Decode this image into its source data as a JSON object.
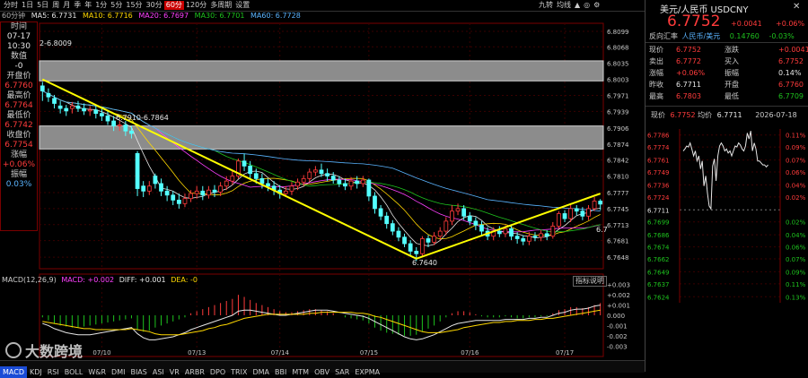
{
  "toolbar": {
    "periods": [
      "分时",
      "1日",
      "5日",
      "周",
      "月",
      "季",
      "年",
      "1分",
      "5分",
      "15分",
      "30分",
      "60分",
      "120分",
      "多周期",
      "设置"
    ],
    "active_period": "60分",
    "right_items": [
      "九转",
      "均线",
      "▲",
      "◎",
      "⚙"
    ]
  },
  "infobar": {
    "period": "60分钟",
    "ma5": "MA5: 6.7731",
    "ma10": "MA10: 6.7716",
    "ma20": "MA20: 6.7697",
    "ma30": "MA30: 6.7701",
    "ma60": "MA60: 6.7728"
  },
  "leftpanel": {
    "items": [
      {
        "label": "时间",
        "value": "07-17",
        "cls": "wht"
      },
      {
        "label": "",
        "value": "10:30",
        "cls": "wht"
      },
      {
        "label": "数值",
        "value": "-0",
        "cls": "wht"
      },
      {
        "label": "开盘价",
        "value": "6.7760",
        "cls": "red"
      },
      {
        "label": "最高价",
        "value": "6.7764",
        "cls": "red"
      },
      {
        "label": "最低价",
        "value": "6.7742",
        "cls": "red"
      },
      {
        "label": "收盘价",
        "value": "6.7754",
        "cls": "red"
      },
      {
        "label": "涨幅",
        "value": "+0.06%",
        "cls": "red"
      },
      {
        "label": "振幅",
        "value": "0.03%",
        "cls": "cyn"
      }
    ]
  },
  "annotations": {
    "zone_top_label": "2-6.8009",
    "zone_mid_label": "6.7910-6.7864",
    "low_label": "6.7640",
    "right_edge_label": "6.7"
  },
  "macd_header": {
    "title": "MACD(12,26,9)",
    "macd": "MACD: +0.002",
    "diff": "DIFF: +0.001",
    "dea": "DEA: -0",
    "button": "指标说明"
  },
  "watermark": "大数跨境",
  "bottom_tabs": [
    "MACD",
    "KDJ",
    "RSI",
    "BOLL",
    "W&R",
    "DMI",
    "BIAS",
    "ASI",
    "VR",
    "ARBR",
    "DPO",
    "TRIX",
    "DMA",
    "BBI",
    "MTM",
    "OBV",
    "SAR",
    "EXPMA"
  ],
  "bottom_active": "MACD",
  "right": {
    "name": "美元/人民币 USDCNY",
    "price": "6.7752",
    "change": "+0.0041",
    "change_pct": "+0.06%",
    "subtitle_label": "反向汇率",
    "subtitle_pair": "人民币/美元",
    "subtitle_rate": "0.14760",
    "subtitle_pct": "-0.03%",
    "rows": [
      {
        "l1": "现价",
        "v1": "6.7752",
        "c1": "red",
        "l2": "涨跌",
        "v2": "+0.0041",
        "c2": "red"
      },
      {
        "l1": "卖出",
        "v1": "6.7772",
        "c1": "red",
        "l2": "买入",
        "v2": "6.7752",
        "c2": "red"
      },
      {
        "l1": "涨幅",
        "v1": "+0.06%",
        "c1": "red",
        "l2": "振幅",
        "v2": "0.14%",
        "c2": "wht"
      },
      {
        "l1": "昨收",
        "v1": "6.7711",
        "c1": "wht",
        "l2": "开盘",
        "v2": "6.7760",
        "c2": "red"
      },
      {
        "l1": "最高",
        "v1": "6.7803",
        "c1": "red",
        "l2": "最低",
        "v2": "6.7709",
        "c2": "grn"
      }
    ],
    "mini_header_price_label": "现价",
    "mini_header_price": "6.7752",
    "mini_header_avg_label": "均价",
    "mini_header_avg": "6.7711",
    "mini_header_date": "2026-07-18"
  },
  "chart_data": [
    {
      "type": "candlestick",
      "title": "",
      "x_labels": [
        "07/10",
        "07/13",
        "07/14",
        "07/15",
        "07/16",
        "07/17"
      ],
      "y_ticks": [
        "6.8099",
        "6.8068",
        "6.8035",
        "6.8003",
        "6.7971",
        "6.7939",
        "6.7906",
        "6.7874",
        "6.7842",
        "6.7810",
        "6.7777",
        "6.7745",
        "6.7713",
        "6.7681",
        "6.7648"
      ],
      "ylim": [
        6.7625,
        6.8115
      ],
      "candles": [
        [
          6.799,
          6.798,
          6.7998,
          6.796
        ],
        [
          6.7975,
          6.7968,
          6.7985,
          6.7958
        ],
        [
          6.7965,
          6.7955,
          6.7972,
          6.7945
        ],
        [
          6.795,
          6.7945,
          6.796,
          6.7935
        ],
        [
          6.7945,
          6.794,
          6.7952,
          6.793
        ],
        [
          6.7945,
          6.795,
          6.7958,
          6.7935
        ],
        [
          6.795,
          6.7945,
          6.796,
          6.7938
        ],
        [
          6.7945,
          6.794,
          6.7955,
          6.7932
        ],
        [
          6.794,
          6.7942,
          6.795,
          6.793
        ],
        [
          6.7942,
          6.7935,
          6.795,
          6.7925
        ],
        [
          6.7935,
          6.793,
          6.7945,
          6.792
        ],
        [
          6.793,
          6.792,
          6.794,
          6.7912
        ],
        [
          6.792,
          6.791,
          6.793,
          6.79
        ],
        [
          6.791,
          6.7912,
          6.792,
          6.79
        ],
        [
          6.7912,
          6.79,
          6.792,
          6.789
        ],
        [
          6.79,
          6.7895,
          6.791,
          6.7885
        ],
        [
          6.7855,
          6.7785,
          6.786,
          6.777
        ],
        [
          6.779,
          6.778,
          6.78,
          6.7768
        ],
        [
          6.778,
          6.779,
          6.78,
          6.7772
        ],
        [
          6.781,
          6.7795,
          6.7815,
          6.7785
        ],
        [
          6.7795,
          6.778,
          6.7805,
          6.777
        ],
        [
          6.778,
          6.7772,
          6.779,
          6.776
        ],
        [
          6.7772,
          6.7762,
          6.778,
          6.7752
        ],
        [
          6.7762,
          6.7755,
          6.7775,
          6.7745
        ],
        [
          6.7755,
          6.7765,
          6.7775,
          6.7748
        ],
        [
          6.7765,
          6.7775,
          6.7782,
          6.7758
        ],
        [
          6.7775,
          6.778,
          6.779,
          6.7765
        ],
        [
          6.778,
          6.7772,
          6.779,
          6.7762
        ],
        [
          6.7772,
          6.7782,
          6.779,
          6.7765
        ],
        [
          6.7782,
          6.7778,
          6.7792,
          6.7768
        ],
        [
          6.7778,
          6.779,
          6.7798,
          6.777
        ],
        [
          6.779,
          6.78,
          6.781,
          6.7782
        ],
        [
          6.78,
          6.781,
          6.782,
          6.7792
        ],
        [
          6.781,
          6.784,
          6.7845,
          6.7805
        ],
        [
          6.784,
          6.783,
          6.7855,
          6.782
        ],
        [
          6.783,
          6.7815,
          6.784,
          6.7805
        ],
        [
          6.7815,
          6.7805,
          6.7825,
          6.7795
        ],
        [
          6.7805,
          6.7795,
          6.7815,
          6.7785
        ],
        [
          6.7795,
          6.779,
          6.7805,
          6.778
        ],
        [
          6.779,
          6.7782,
          6.78,
          6.7772
        ],
        [
          6.7782,
          6.7775,
          6.7792,
          6.7765
        ],
        [
          6.7775,
          6.778,
          6.779,
          6.7768
        ],
        [
          6.778,
          6.779,
          6.7798,
          6.7772
        ],
        [
          6.779,
          6.7798,
          6.7805,
          6.7782
        ],
        [
          6.7798,
          6.7805,
          6.7812,
          6.779
        ],
        [
          6.7805,
          6.7818,
          6.7825,
          6.7798
        ],
        [
          6.7818,
          6.7822,
          6.783,
          6.781
        ],
        [
          6.7822,
          6.7815,
          6.7835,
          6.7808
        ],
        [
          6.7815,
          6.781,
          6.7825,
          6.78
        ],
        [
          6.781,
          6.7802,
          6.7818,
          6.7795
        ],
        [
          6.7802,
          6.7795,
          6.781,
          6.7788
        ],
        [
          6.7795,
          6.779,
          6.7805,
          6.7782
        ],
        [
          6.779,
          6.78,
          6.7808,
          6.7782
        ],
        [
          6.78,
          6.7795,
          6.781,
          6.7785
        ],
        [
          6.7795,
          6.7802,
          6.781,
          6.7788
        ],
        [
          6.7802,
          6.777,
          6.7805,
          6.776
        ],
        [
          6.777,
          6.7745,
          6.7778,
          6.7735
        ],
        [
          6.7745,
          6.773,
          6.7752,
          6.7722
        ],
        [
          6.773,
          6.7715,
          6.7738,
          6.7705
        ],
        [
          6.7715,
          6.77,
          6.7722,
          6.7692
        ],
        [
          6.77,
          6.7688,
          6.7708,
          6.768
        ],
        [
          6.7688,
          6.7675,
          6.7695,
          6.7668
        ],
        [
          6.7675,
          6.766,
          6.7682,
          6.7652
        ],
        [
          6.766,
          6.7655,
          6.7668,
          6.764
        ],
        [
          6.7655,
          6.7685,
          6.769,
          6.7648
        ],
        [
          6.7685,
          6.7678,
          6.7692,
          6.7668
        ],
        [
          6.7678,
          6.769,
          6.7698,
          6.7672
        ],
        [
          6.769,
          6.77,
          6.7708,
          6.7682
        ],
        [
          6.77,
          6.772,
          6.7728,
          6.7692
        ],
        [
          6.772,
          6.774,
          6.7752,
          6.7712
        ],
        [
          6.774,
          6.7745,
          6.7755,
          6.7732
        ],
        [
          6.7745,
          6.773,
          6.7752,
          6.7722
        ],
        [
          6.773,
          6.772,
          6.7738,
          6.7712
        ],
        [
          6.772,
          6.7712,
          6.7728,
          6.7702
        ],
        [
          6.7712,
          6.77,
          6.772,
          6.7692
        ],
        [
          6.77,
          6.769,
          6.7708,
          6.7682
        ],
        [
          6.769,
          6.77,
          6.7708,
          6.7682
        ],
        [
          6.77,
          6.7695,
          6.771,
          6.7688
        ],
        [
          6.7695,
          6.7705,
          6.7712,
          6.7688
        ],
        [
          6.7705,
          6.769,
          6.7712,
          6.7682
        ],
        [
          6.769,
          6.7685,
          6.7698,
          6.7675
        ],
        [
          6.7685,
          6.768,
          6.7692,
          6.7672
        ],
        [
          6.768,
          6.769,
          6.7698,
          6.7672
        ],
        [
          6.769,
          6.7688,
          6.7698,
          6.768
        ],
        [
          6.7688,
          6.7695,
          6.7702,
          6.768
        ],
        [
          6.7695,
          6.769,
          6.7702,
          6.7682
        ],
        [
          6.769,
          6.771,
          6.7718,
          6.7685
        ],
        [
          6.771,
          6.7735,
          6.774,
          6.7705
        ],
        [
          6.7735,
          6.7725,
          6.7742,
          6.7718
        ],
        [
          6.7725,
          6.7745,
          6.7752,
          6.7718
        ],
        [
          6.7745,
          6.774,
          6.7752,
          6.7732
        ],
        [
          6.774,
          6.773,
          6.7748,
          6.7722
        ],
        [
          6.773,
          6.7745,
          6.7752,
          6.7722
        ],
        [
          6.7745,
          6.776,
          6.7768,
          6.774
        ],
        [
          6.776,
          6.7754,
          6.7764,
          6.7742
        ]
      ],
      "trendlines": [
        {
          "from_index": 0,
          "from_value": 6.8003,
          "to_index": 63,
          "to_value": 6.7645
        },
        {
          "from_index": 63,
          "from_value": 6.7645,
          "to_index": 94,
          "to_value": 6.7775
        }
      ],
      "zones": [
        {
          "top": 6.804,
          "bottom": 6.8
        },
        {
          "top": 6.791,
          "bottom": 6.7864
        }
      ]
    },
    {
      "type": "macd",
      "title": "MACD(12,26,9)",
      "y_ticks": [
        "+0.003",
        "+0.002",
        "+0.001",
        "0.000",
        "-0.001",
        "-0.002",
        "-0.003"
      ],
      "ylim": [
        -0.0035,
        0.0035
      ],
      "histogram": [
        -0.0002,
        -0.0005,
        -0.0008,
        -0.001,
        -0.0011,
        -0.0012,
        -0.0012,
        -0.0011,
        -0.001,
        -0.0009,
        -0.0008,
        -0.0007,
        -0.0006,
        -0.0005,
        -0.0004,
        -0.0003,
        -0.0014,
        -0.0016,
        -0.0015,
        -0.0012,
        -0.001,
        -0.0008,
        -0.0006,
        -0.0004,
        -0.0002,
        0.0002,
        0.0004,
        0.0006,
        0.0008,
        0.001,
        0.0012,
        0.0014,
        0.0016,
        0.002,
        0.0018,
        0.0015,
        0.0012,
        0.001,
        0.0008,
        0.0006,
        0.0004,
        0.0003,
        0.0003,
        0.0004,
        0.0005,
        0.0006,
        0.0006,
        0.0005,
        0.0004,
        0.0002,
        0.0,
        -0.0002,
        -0.0003,
        -0.0004,
        -0.0005,
        -0.0008,
        -0.0012,
        -0.0015,
        -0.0017,
        -0.0018,
        -0.0019,
        -0.002,
        -0.002,
        -0.0019,
        -0.0016,
        -0.0013,
        -0.001,
        -0.0006,
        -0.0002,
        0.0002,
        0.0004,
        0.0004,
        0.0003,
        0.0001,
        -0.0001,
        -0.0002,
        -0.0002,
        -0.0002,
        -0.0001,
        -0.0002,
        -0.0003,
        -0.0003,
        -0.0002,
        -0.0002,
        -0.0001,
        -0.0001,
        0.0002,
        0.0005,
        0.0006,
        0.0008,
        0.0008,
        0.0007,
        0.0008,
        0.001,
        0.0012
      ],
      "diff": [
        -0.0008,
        -0.001,
        -0.0013,
        -0.0015,
        -0.0017,
        -0.0018,
        -0.0019,
        -0.0019,
        -0.0019,
        -0.0018,
        -0.0017,
        -0.0016,
        -0.0015,
        -0.0014,
        -0.0013,
        -0.0012,
        -0.0018,
        -0.0022,
        -0.0024,
        -0.0024,
        -0.0023,
        -0.0022,
        -0.0021,
        -0.0019,
        -0.0017,
        -0.0014,
        -0.0012,
        -0.001,
        -0.0008,
        -0.0006,
        -0.0004,
        -0.0002,
        0.0,
        0.0004,
        0.0005,
        0.0005,
        0.0004,
        0.0003,
        0.0002,
        0.0001,
        0.0,
        0.0,
        0.0001,
        0.0002,
        0.0003,
        0.0004,
        0.0005,
        0.0005,
        0.0005,
        0.0004,
        0.0003,
        0.0002,
        0.0001,
        0.0,
        -0.0001,
        -0.0003,
        -0.0006,
        -0.0009,
        -0.0012,
        -0.0015,
        -0.0018,
        -0.0021,
        -0.0023,
        -0.0024,
        -0.0023,
        -0.0021,
        -0.0019,
        -0.0016,
        -0.0013,
        -0.001,
        -0.0008,
        -0.0007,
        -0.0006,
        -0.0005,
        -0.0005,
        -0.0005,
        -0.0005,
        -0.0005,
        -0.0004,
        -0.0004,
        -0.0004,
        -0.0004,
        -0.0003,
        -0.0003,
        -0.0002,
        -0.0002,
        0.0,
        0.0002,
        0.0003,
        0.0005,
        0.0006,
        0.0006,
        0.0007,
        0.0009,
        0.001
      ],
      "dea": [
        -0.0006,
        -0.0007,
        -0.0008,
        -0.0009,
        -0.001,
        -0.0011,
        -0.0012,
        -0.0013,
        -0.0013,
        -0.0014,
        -0.0014,
        -0.0014,
        -0.0014,
        -0.0014,
        -0.0014,
        -0.0013,
        -0.0014,
        -0.0015,
        -0.0016,
        -0.0018,
        -0.0019,
        -0.0019,
        -0.0019,
        -0.0019,
        -0.0018,
        -0.0017,
        -0.0016,
        -0.0015,
        -0.0013,
        -0.0012,
        -0.001,
        -0.0009,
        -0.0007,
        -0.0005,
        -0.0003,
        -0.0002,
        -0.0001,
        0.0,
        0.0001,
        0.0001,
        0.0001,
        0.0001,
        0.0001,
        0.0001,
        0.0001,
        0.0002,
        0.0002,
        0.0003,
        0.0003,
        0.0003,
        0.0003,
        0.0003,
        0.0003,
        0.0002,
        0.0002,
        0.0001,
        -0.0001,
        -0.0002,
        -0.0004,
        -0.0006,
        -0.0008,
        -0.001,
        -0.0012,
        -0.0014,
        -0.0016,
        -0.0017,
        -0.0017,
        -0.0017,
        -0.0016,
        -0.0015,
        -0.0014,
        -0.0012,
        -0.0011,
        -0.001,
        -0.0009,
        -0.0008,
        -0.0007,
        -0.0007,
        -0.0006,
        -0.0006,
        -0.0005,
        -0.0005,
        -0.0005,
        -0.0004,
        -0.0004,
        -0.0003,
        -0.0003,
        -0.0002,
        -0.0001,
        0.0,
        0.0001,
        0.0002,
        0.0003,
        0.0004,
        0.0005
      ]
    },
    {
      "type": "line",
      "title": "",
      "y_ticks": [
        "6.7786",
        "6.7774",
        "6.7761",
        "6.7749",
        "6.7736",
        "6.7724",
        "6.7711",
        "6.7699",
        "6.7686",
        "6.7674",
        "6.7662",
        "6.7649",
        "6.7637",
        "6.7624"
      ],
      "pct_ticks": [
        "0.11%",
        "0.09%",
        "0.07%",
        "0.06%",
        "0.04%",
        "0.02%",
        "",
        "0.02%",
        "0.04%",
        "0.06%",
        "0.07%",
        "0.09%",
        "0.11%",
        "0.13%"
      ],
      "ylim": [
        6.7618,
        6.7792
      ],
      "values": [
        6.777,
        6.7772,
        6.7775,
        6.7774,
        6.7778,
        6.7772,
        6.7765,
        6.777,
        6.776,
        6.7765,
        6.7752,
        6.776,
        6.7735,
        6.7745,
        6.7728,
        6.7715,
        6.7712,
        6.7755,
        6.7762,
        6.774,
        6.7765,
        6.7775,
        6.7778,
        6.7775,
        6.777,
        6.7772,
        6.7768,
        6.777,
        6.7765,
        6.777,
        6.7775,
        6.7774,
        6.7778,
        6.7776,
        6.7772,
        6.777,
        6.7775,
        6.7788,
        6.7782,
        6.779,
        6.777,
        6.7778,
        6.7772,
        6.776,
        6.776,
        6.7758,
        6.7756,
        6.7756,
        6.7754,
        6.7756
      ]
    }
  ]
}
